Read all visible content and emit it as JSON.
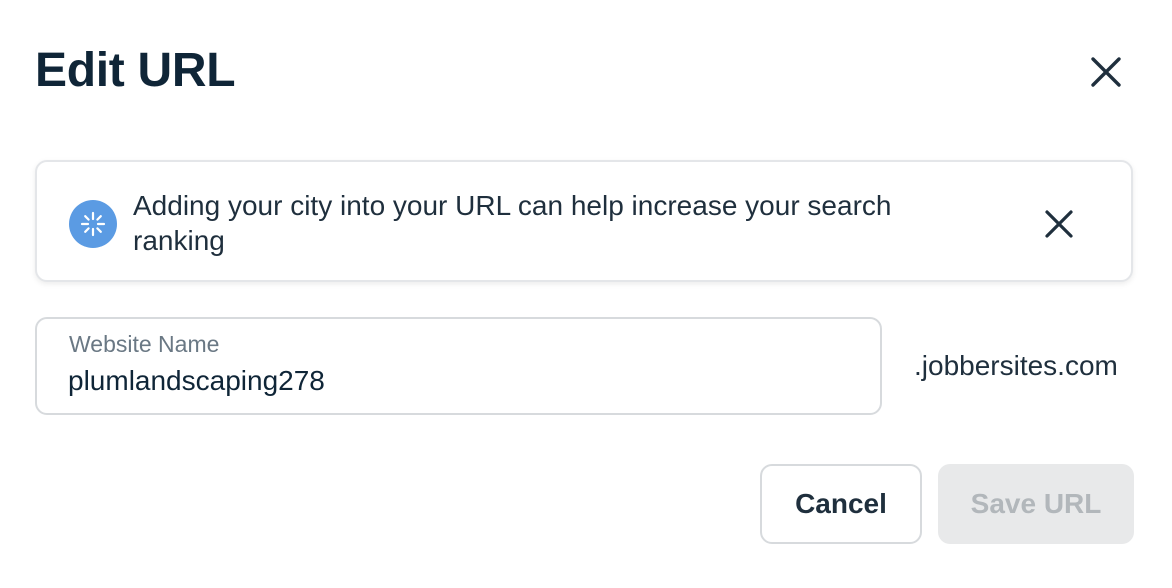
{
  "dialog": {
    "title": "Edit URL",
    "close_icon": "close-icon"
  },
  "banner": {
    "icon": "sparkle-icon",
    "message": "Adding your city into your URL can help increase your search ranking",
    "dismiss_icon": "close-icon"
  },
  "website_field": {
    "label": "Website Name",
    "value": "plumlandscaping278",
    "suffix": ".jobbersites.com"
  },
  "actions": {
    "cancel_label": "Cancel",
    "save_label": "Save URL",
    "save_disabled": true
  },
  "colors": {
    "title": "#0f2537",
    "banner_icon_bg": "#5b9be3",
    "disabled_button_bg": "#e8e9ea",
    "disabled_button_text": "#b2b7bb"
  }
}
